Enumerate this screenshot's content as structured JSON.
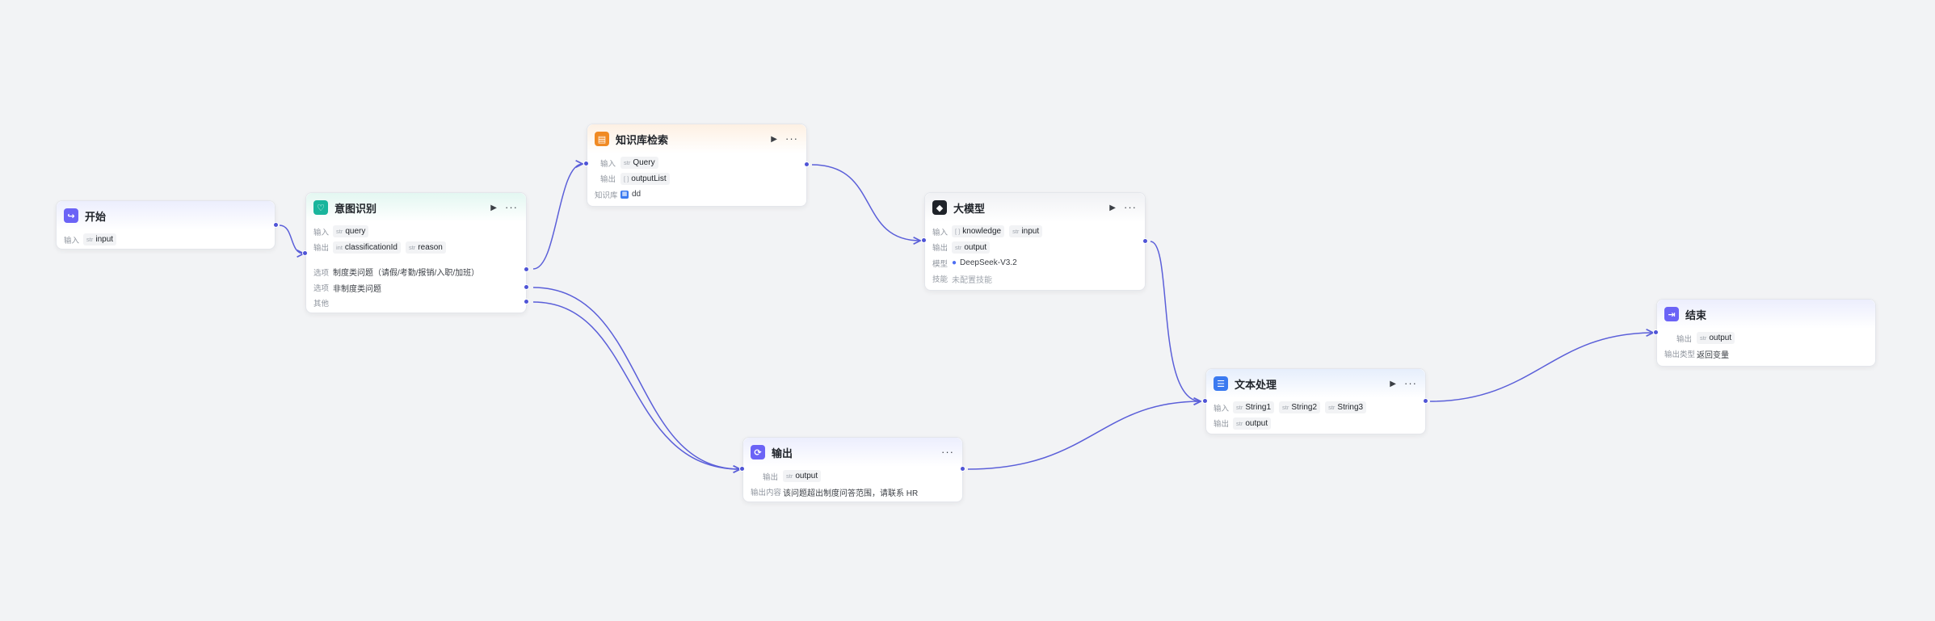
{
  "nodes": {
    "start": {
      "title": "开始",
      "input_label": "输入",
      "input_var": {
        "type": "str",
        "name": "input"
      }
    },
    "intent": {
      "title": "意图识别",
      "input_label": "输入",
      "input_var": {
        "type": "str",
        "name": "query"
      },
      "output_label": "输出",
      "output_vars": [
        {
          "type": "int",
          "name": "classificationId"
        },
        {
          "type": "str",
          "name": "reason"
        }
      ],
      "options": [
        {
          "label": "选项",
          "text": "制度类问题（请假/考勤/报销/入职/加班）"
        },
        {
          "label": "选项",
          "text": "非制度类问题"
        },
        {
          "label": "其他",
          "text": ""
        }
      ]
    },
    "knowledge": {
      "title": "知识库检索",
      "input_label": "输入",
      "input_var": {
        "type": "str",
        "name": "Query"
      },
      "output_label": "输出",
      "output_var": {
        "type": "[ ]",
        "name": "outputList"
      },
      "kb_label": "知识库",
      "kb_name": "dd"
    },
    "llm": {
      "title": "大模型",
      "input_label": "输入",
      "input_vars": [
        {
          "type": "[ ]",
          "name": "knowledge"
        },
        {
          "type": "str",
          "name": "input"
        }
      ],
      "output_label": "输出",
      "output_var": {
        "type": "str",
        "name": "output"
      },
      "model_label": "模型",
      "model_name": "DeepSeek-V3.2",
      "skill_label": "技能",
      "skill_text": "未配置技能"
    },
    "output": {
      "title": "输出",
      "output_label": "输出",
      "output_var": {
        "type": "str",
        "name": "output"
      },
      "content_label": "输出内容",
      "content_text": "该问题超出制度问答范围，请联系 HR"
    },
    "text": {
      "title": "文本处理",
      "input_label": "输入",
      "input_vars": [
        {
          "type": "str",
          "name": "String1"
        },
        {
          "type": "str",
          "name": "String2"
        },
        {
          "type": "str",
          "name": "String3"
        }
      ],
      "output_label": "输出",
      "output_var": {
        "type": "str",
        "name": "output"
      }
    },
    "end": {
      "title": "结束",
      "output_label": "输出",
      "output_var": {
        "type": "str",
        "name": "output"
      },
      "type_label": "输出类型",
      "type_text": "返回变量"
    }
  },
  "icons": {
    "start": "start-icon",
    "intent": "intent-icon",
    "knowledge": "knowledge-base-icon",
    "llm": "llm-icon",
    "output": "output-icon",
    "text": "text-processing-icon",
    "end": "end-icon",
    "run": "play-icon",
    "more": "more-icon"
  },
  "colors": {
    "edge": "#5b5fd9",
    "port": "#4f54d6",
    "canvas": "#f2f3f5"
  }
}
